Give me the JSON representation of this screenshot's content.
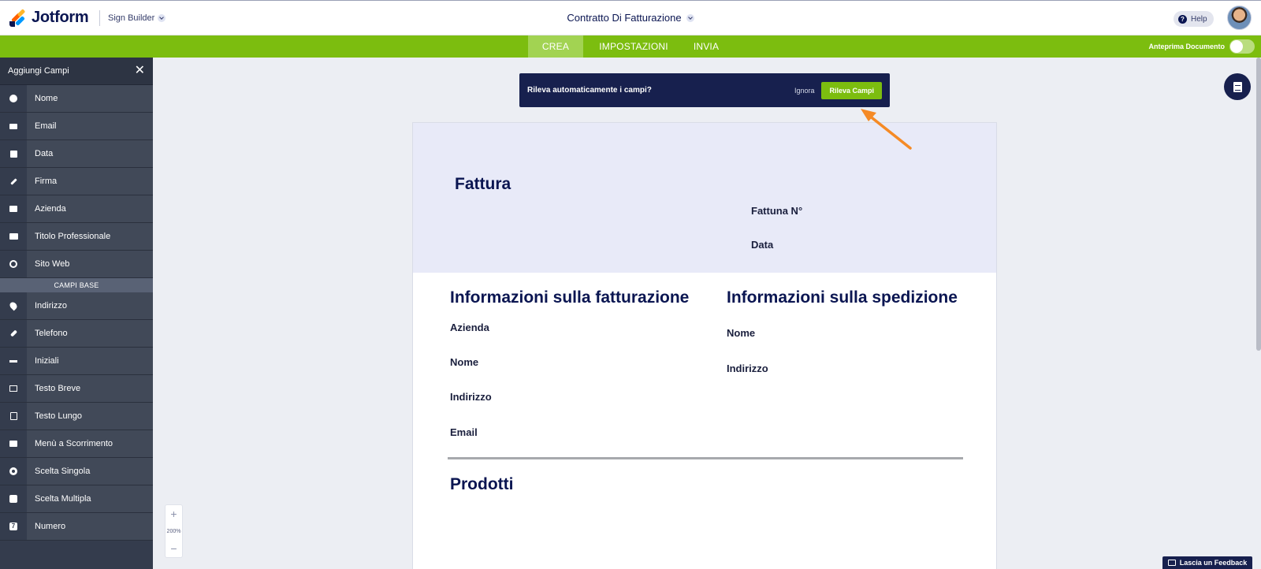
{
  "header": {
    "logo_text": "Jotform",
    "app_name": "Sign Builder",
    "document_title": "Contratto Di Fatturazione",
    "help_label": "Help"
  },
  "tabs": [
    {
      "label": "CREA",
      "active": true
    },
    {
      "label": "IMPOSTAZIONI",
      "active": false
    },
    {
      "label": "INVIA",
      "active": false
    }
  ],
  "preview_toggle": {
    "label": "Anteprima Documento",
    "on": false
  },
  "sidebar": {
    "title": "Aggiungi Campi",
    "items_top": [
      {
        "label": "Nome",
        "icon": "user-icon"
      },
      {
        "label": "Email",
        "icon": "envelope-icon"
      },
      {
        "label": "Data",
        "icon": "calendar-icon"
      },
      {
        "label": "Firma",
        "icon": "pen-icon"
      },
      {
        "label": "Azienda",
        "icon": "building-icon"
      },
      {
        "label": "Titolo Professionale",
        "icon": "id-card-icon"
      },
      {
        "label": "Sito Web",
        "icon": "globe-icon"
      }
    ],
    "section_label": "CAMPI BASE",
    "items_bottom": [
      {
        "label": "Indirizzo",
        "icon": "map-pin-icon"
      },
      {
        "label": "Telefono",
        "icon": "phone-icon"
      },
      {
        "label": "Iniziali",
        "icon": "initials-icon"
      },
      {
        "label": "Testo Breve",
        "icon": "short-text-icon"
      },
      {
        "label": "Testo Lungo",
        "icon": "long-text-icon"
      },
      {
        "label": "Menù a Scorrimento",
        "icon": "dropdown-icon"
      },
      {
        "label": "Scelta Singola",
        "icon": "radio-icon"
      },
      {
        "label": "Scelta Multipla",
        "icon": "checkbox-icon"
      },
      {
        "label": "Numero",
        "icon": "number-icon",
        "glyph": "7"
      }
    ]
  },
  "banner": {
    "text": "Rileva automaticamente i campi?",
    "ignore_label": "Ignora",
    "detect_label": "Rileva Campi"
  },
  "document": {
    "title": "Fattura",
    "invoice_number_label": "Fattuna N°",
    "date_label": "Data",
    "billing_heading": "Informazioni sulla fatturazione",
    "billing_fields": [
      "Azienda",
      "Nome",
      "Indirizzo",
      "Email"
    ],
    "shipping_heading": "Informazioni sulla spedizione",
    "shipping_fields": [
      "Nome",
      "Indirizzo"
    ],
    "products_heading": "Prodotti"
  },
  "zoom": {
    "plus": "+",
    "value": "200%",
    "minus": "−"
  },
  "feedback_label": "Lascia un Feedback",
  "colors": {
    "brand_green": "#7cbd0f",
    "navy": "#17204e",
    "sidebar_bg": "#343c4d",
    "accent_orange": "#f58a25"
  }
}
